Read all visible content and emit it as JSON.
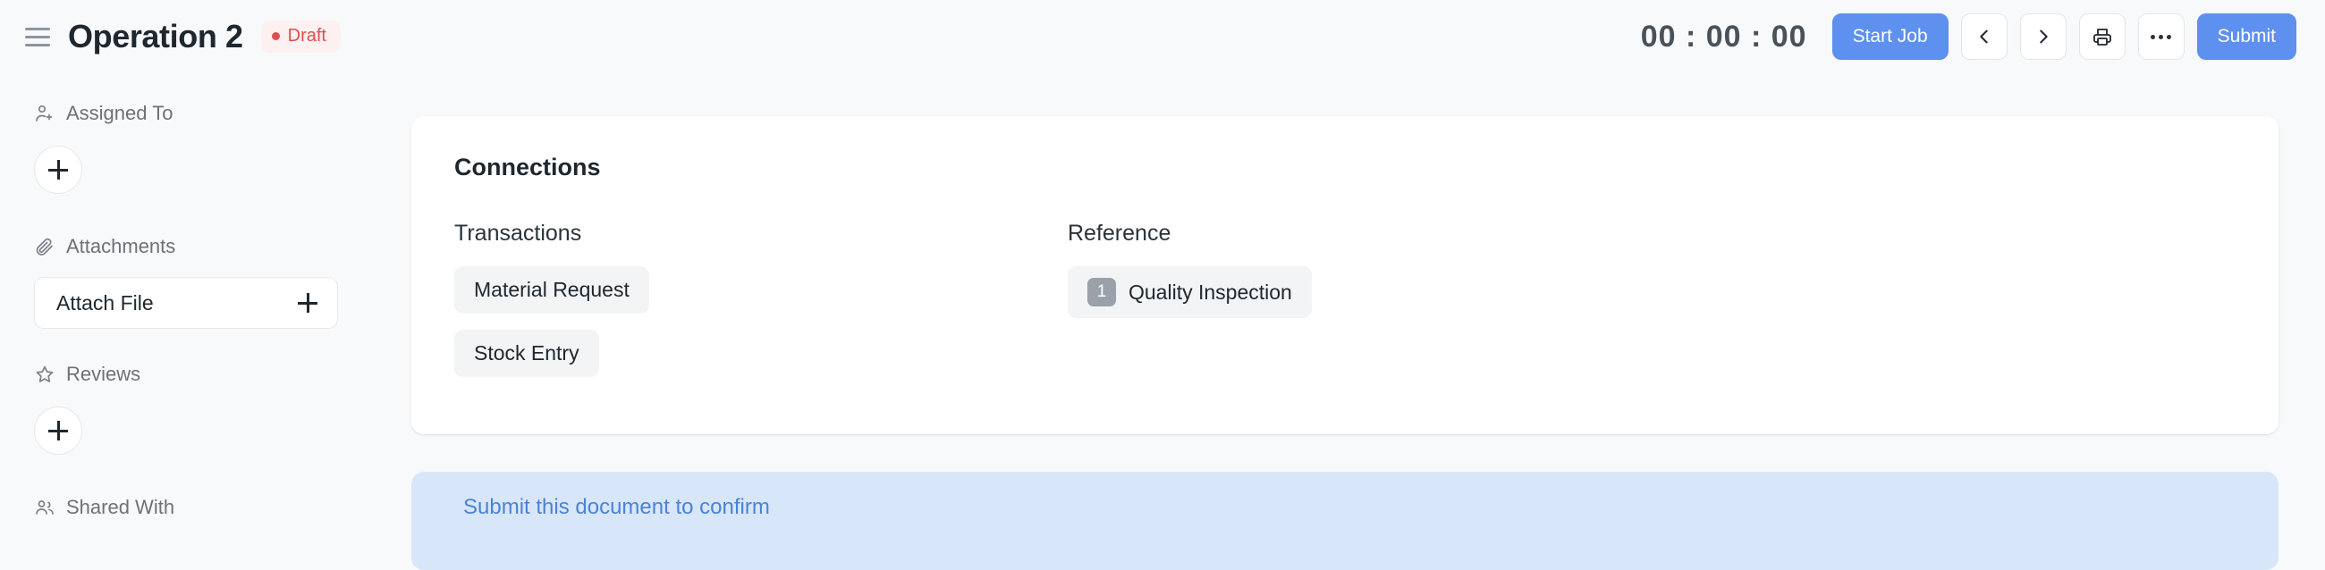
{
  "header": {
    "menu_icon": "hamburger-icon",
    "title": "Operation 2",
    "status": "Draft",
    "status_color": "#e24c4c",
    "timer": "00 : 00 : 00",
    "start_job_label": "Start Job",
    "prev_icon": "chevron-left-icon",
    "next_icon": "chevron-right-icon",
    "print_icon": "printer-icon",
    "more_icon": "ellipsis-icon",
    "submit_label": "Submit",
    "primary_color": "#5e90ef"
  },
  "sidebar": {
    "sections": [
      {
        "icon": "user-plus-icon",
        "label": "Assigned To",
        "action": "add-assignment-button"
      },
      {
        "icon": "paperclip-icon",
        "label": "Attachments",
        "action": "attach-file-button"
      },
      {
        "icon": "star-icon",
        "label": "Reviews",
        "action": "add-review-button"
      },
      {
        "icon": "users-icon",
        "label": "Shared With",
        "action": null
      }
    ],
    "attach_file_label": "Attach File",
    "attach_file_icon": "plus-icon",
    "add_icon": "plus-icon"
  },
  "main": {
    "card_title": "Connections",
    "columns": [
      {
        "title": "Transactions",
        "links": [
          {
            "label": "Material Request",
            "count": null
          },
          {
            "label": "Stock Entry",
            "count": null
          }
        ]
      },
      {
        "title": "Reference",
        "links": [
          {
            "label": "Quality Inspection",
            "count": "1"
          }
        ]
      }
    ],
    "banner_text": "Submit this document to confirm",
    "banner_bg": "#d8e6f9",
    "banner_fg": "#4a82d8"
  }
}
